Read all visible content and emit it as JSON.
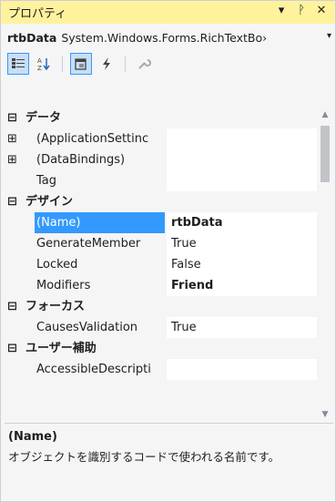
{
  "window": {
    "title": "プロパティ",
    "buttons": {
      "dropdown": "▾",
      "pin": "ᚹ",
      "close": "✕"
    }
  },
  "object_selector": {
    "name": "rtbData",
    "type": "System.Windows.Forms.RichTextBo›",
    "dropdown": "▾"
  },
  "toolbar": {
    "buttons": [
      {
        "icon": "categorized-icon",
        "active": true
      },
      {
        "icon": "alphabetical-icon",
        "active": false
      },
      {
        "icon": "properties-icon",
        "active": true
      },
      {
        "icon": "events-icon",
        "active": false
      },
      {
        "icon": "property-pages-icon",
        "active": false
      }
    ]
  },
  "grid": {
    "rows": [
      {
        "kind": "category",
        "glyph": "⊟",
        "label": "データ"
      },
      {
        "kind": "property",
        "glyph": "⊞",
        "name": "(ApplicationSettinc",
        "value": ""
      },
      {
        "kind": "property",
        "glyph": "⊞",
        "name": "(DataBindings)",
        "value": ""
      },
      {
        "kind": "property",
        "name": "Tag",
        "value": ""
      },
      {
        "kind": "category",
        "glyph": "⊟",
        "label": "デザイン"
      },
      {
        "kind": "property",
        "name": "(Name)",
        "value": "rtbData",
        "selected": true,
        "bold": true
      },
      {
        "kind": "property",
        "name": "GenerateMember",
        "value": "True"
      },
      {
        "kind": "property",
        "name": "Locked",
        "value": "False"
      },
      {
        "kind": "property",
        "name": "Modifiers",
        "value": "Friend",
        "bold": true
      },
      {
        "kind": "category",
        "glyph": "⊟",
        "label": "フォーカス"
      },
      {
        "kind": "property",
        "name": "CausesValidation",
        "value": "True"
      },
      {
        "kind": "category",
        "glyph": "⊟",
        "label": "ユーザー補助"
      },
      {
        "kind": "property",
        "name": "AccessibleDescripti",
        "value": ""
      }
    ]
  },
  "description": {
    "title": "(Name)",
    "text": "オブジェクトを識別するコードで使われる名前です。"
  },
  "colors": {
    "titlebar": "#fff29d",
    "selection": "#3399ff",
    "background": "#f5f5f5"
  }
}
